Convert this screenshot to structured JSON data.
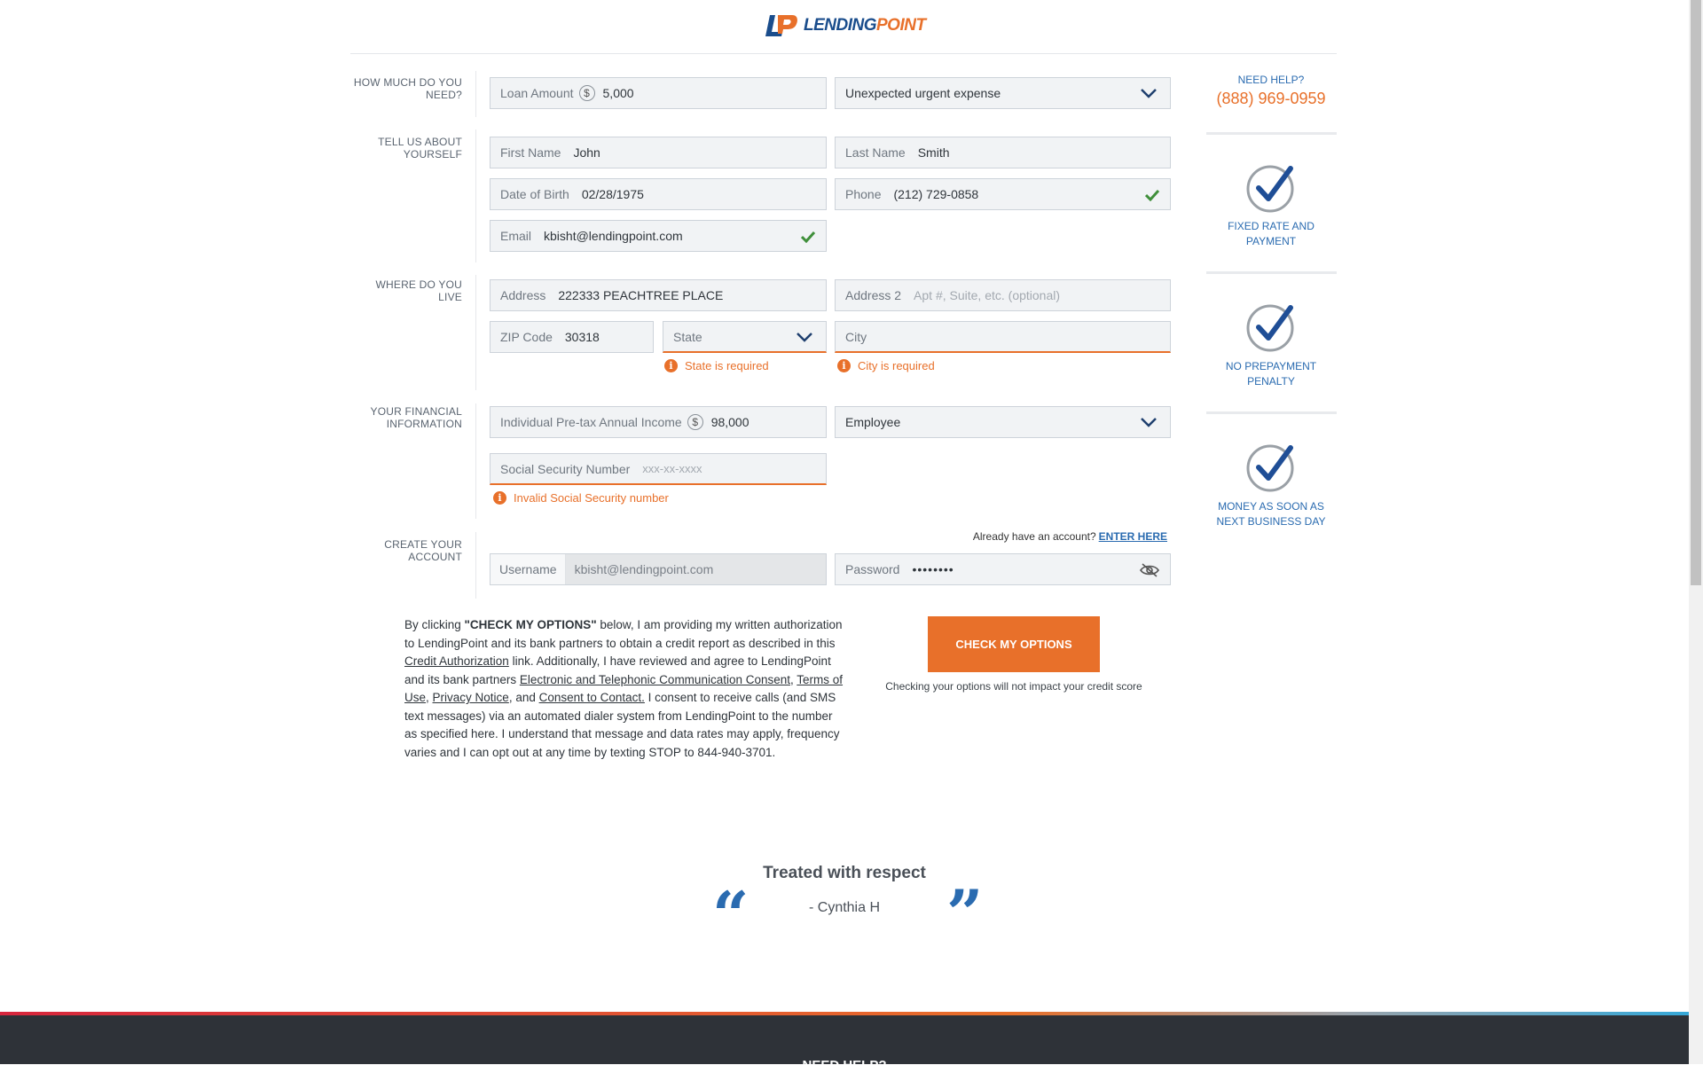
{
  "brand": {
    "logo_text_main": "LENDING",
    "logo_text_accent": "POINT",
    "accent_color": "#e8702a",
    "primary_color": "#2a6bb0"
  },
  "sections": {
    "how_much": "HOW MUCH DO YOU NEED?",
    "about": "TELL US ABOUT YOURSELF",
    "live": "WHERE DO YOU LIVE",
    "financial": "YOUR FINANCIAL INFORMATION",
    "account": "CREATE YOUR ACCOUNT"
  },
  "form": {
    "loan_amount": {
      "label": "Loan Amount",
      "currency": "$",
      "value": "5,000"
    },
    "loan_purpose": {
      "value": "Unexpected urgent expense"
    },
    "first_name": {
      "label": "First Name",
      "value": "John"
    },
    "last_name": {
      "label": "Last Name",
      "value": "Smith"
    },
    "dob": {
      "label": "Date of Birth",
      "value": "02/28/1975"
    },
    "phone": {
      "label": "Phone",
      "value": "(212) 729-0858"
    },
    "email": {
      "label": "Email",
      "value": "kbisht@lendingpoint.com"
    },
    "address": {
      "label": "Address",
      "value": "222333 PEACHTREE PLACE"
    },
    "address2": {
      "label": "Address 2",
      "placeholder": "Apt #, Suite, etc. (optional)"
    },
    "zip": {
      "label": "ZIP Code",
      "value": "30318"
    },
    "state": {
      "placeholder": "State",
      "error": "State is required"
    },
    "city": {
      "placeholder": "City",
      "error": "City is required"
    },
    "income": {
      "label": "Individual Pre-tax Annual Income",
      "currency": "$",
      "value": "98,000"
    },
    "employment": {
      "value": "Employee"
    },
    "ssn": {
      "label": "Social Security Number",
      "placeholder": "xxx-xx-xxxx",
      "error": "Invalid Social Security number"
    },
    "already_account": "Already have an account?",
    "enter_here": "ENTER HERE",
    "username": {
      "label": "Username",
      "value": "kbisht@lendingpoint.com"
    },
    "password": {
      "label": "Password",
      "value": "••••••••"
    }
  },
  "sidebar": {
    "need_help": "NEED HELP?",
    "phone": "(888) 969-0959",
    "features": [
      {
        "icon": "check-circle-icon",
        "text": "FIXED RATE AND PAYMENT"
      },
      {
        "icon": "check-circle-icon",
        "text": "NO PREPAYMENT PENALTY"
      },
      {
        "icon": "check-circle-icon",
        "text": "MONEY AS SOON AS NEXT BUSINESS DAY"
      }
    ]
  },
  "consent": {
    "t1": "By clicking ",
    "b1": "\"CHECK MY OPTIONS\"",
    "t2": " below, I am providing my written authorization to LendingPoint and its bank partners to obtain a credit report as described in this ",
    "l1": "Credit Authorization",
    "t3": " link. Additionally, I have reviewed and agree to LendingPoint and its bank partners ",
    "l2": "Electronic and Telephonic Communication Consent",
    "t4": ", ",
    "l3": "Terms of Use",
    "t5": ", ",
    "l4": "Privacy Notice",
    "t6": ", and ",
    "l5": "Consent to Contact.",
    "t7": " I consent to receive calls (and SMS text messages) via an automated dialer system from LendingPoint to the number as specified here. I understand that message and data rates may apply, frequency varies and I can opt out at any time by texting STOP to 844-940-3701."
  },
  "cta": {
    "label": "CHECK MY OPTIONS",
    "note": "Checking your options will not impact your credit score"
  },
  "testimonial": {
    "title": "Treated with respect",
    "author": "- Cynthia H",
    "open_quote": "“",
    "close_quote": "”"
  },
  "footer": {
    "title": "NEED HELP?"
  }
}
